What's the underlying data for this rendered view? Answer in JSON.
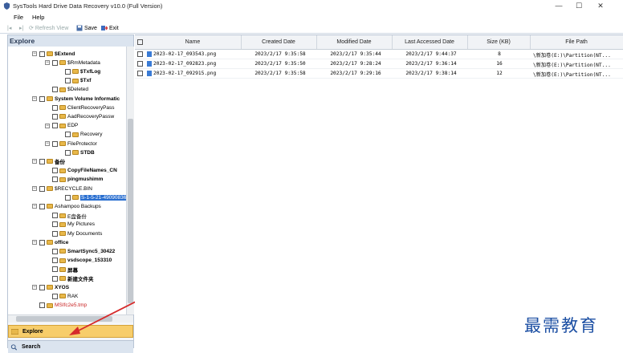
{
  "window": {
    "title": "SysTools Hard Drive Data Recovery v10.0 (Full Version)",
    "minimize": "—",
    "maximize": "☐",
    "close": "✕"
  },
  "menu": {
    "file": "File",
    "help": "Help"
  },
  "toolbar": {
    "refresh_view": "Refresh View",
    "save": "Save",
    "exit": "Exit"
  },
  "explore_panel": {
    "header": "Explore",
    "explore_button": "Explore",
    "search_button": "Search"
  },
  "tree": [
    {
      "label": "$Extend",
      "exp": "−",
      "bold": true
    },
    {
      "label": "$RmMetadata",
      "exp": "⊟"
    },
    {
      "label": "$TxfLog",
      "bold": true
    },
    {
      "label": "$Txf",
      "bold": true
    },
    {
      "label": "$Deleted"
    },
    {
      "label": "System Volume Informatic",
      "bold": true
    },
    {
      "label": "ClientRecoveryPass"
    },
    {
      "label": "AadRecoveryPassw"
    },
    {
      "label": "EDP"
    },
    {
      "label": "Recovery"
    },
    {
      "label": "FileProtector"
    },
    {
      "label": "STDB",
      "bold": true
    },
    {
      "label": "备份",
      "bold": true
    },
    {
      "label": "CopyFileNames_CN",
      "bold": true
    },
    {
      "label": "pingmushimm",
      "bold": true
    },
    {
      "label": "$RECYCLE.BIN"
    },
    {
      "label": "S-1-5-21-490908366-4",
      "selected": true
    },
    {
      "label": "Ashampoo Backups"
    },
    {
      "label": "E盘备份"
    },
    {
      "label": "My Pictures"
    },
    {
      "label": "My Documents"
    },
    {
      "label": "office",
      "bold": true
    },
    {
      "label": "SmartSync5_30422",
      "bold": true
    },
    {
      "label": "vsdscope_153310",
      "bold": true
    },
    {
      "label": "屏幕",
      "bold": true
    },
    {
      "label": "新建文件夹",
      "bold": true
    },
    {
      "label": "XYOS",
      "bold": true
    },
    {
      "label": "RAK"
    },
    {
      "label": "MSIfc2e5.tmp",
      "red": true
    }
  ],
  "table": {
    "columns": [
      "Name",
      "Created Date",
      "Modified Date",
      "Last Accessed Date",
      "Size (KB)",
      "File Path"
    ],
    "rows": [
      [
        "2023-02-17_093543.png",
        "2023/2/17 9:35:58",
        "2023/2/17 9:35:44",
        "2023/2/17 9:44:37",
        "8",
        "\\新加卷(E:)\\Partition(NT..."
      ],
      [
        "2023-02-17_092823.png",
        "2023/2/17 9:35:50",
        "2023/2/17 9:28:24",
        "2023/2/17 9:36:14",
        "16",
        "\\新加卷(E:)\\Partition(NT..."
      ],
      [
        "2023-02-17_092915.png",
        "2023/2/17 9:35:58",
        "2023/2/17 9:29:16",
        "2023/2/17 9:38:14",
        "12",
        "\\新加卷(E:)\\Partition(NT..."
      ]
    ]
  },
  "watermark": "最需教育"
}
